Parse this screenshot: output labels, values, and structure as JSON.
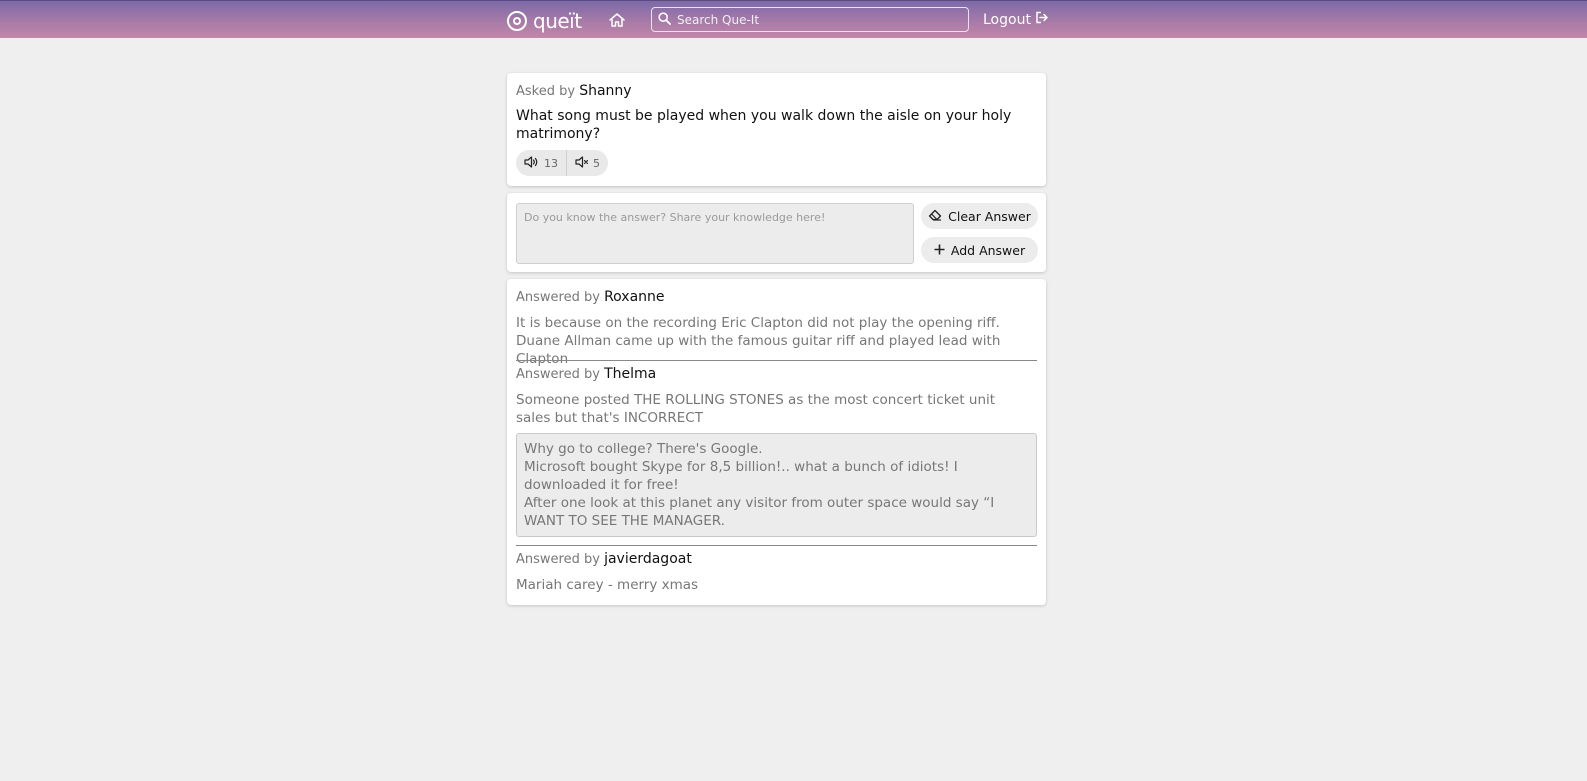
{
  "header": {
    "brand": "queït",
    "search_placeholder": "Search Que-It",
    "logout_label": "Logout"
  },
  "question": {
    "asked_prefix": "Asked by",
    "author": "Shanny",
    "text": "What song must be played when you walk down the aisle on your holy matrimony?",
    "upvotes": "13",
    "downvotes": "5"
  },
  "answer_form": {
    "placeholder": "Do you know the answer? Share your knowledge here!",
    "clear_label": "Clear Answer",
    "add_label": "Add Answer"
  },
  "answers": [
    {
      "prefix": "Answered by",
      "author": "Roxanne",
      "text": "It is because on the recording Eric Clapton did not play the opening riff. Duane Allman came up with the famous guitar riff and played lead with Clapton"
    },
    {
      "prefix": "Answered by",
      "author": "Thelma",
      "text": "Someone posted THE ROLLING STONES as the most concert ticket unit sales but that's INCORRECT",
      "quote_lines": [
        "Why go to college? There's Google.",
        "Microsoft bought Skype for 8,5 billion!.. what a bunch of idiots! I downloaded it for free!",
        "After one look at this planet any visitor from outer space would say “I WANT TO SEE THE MANAGER."
      ]
    },
    {
      "prefix": "Answered by",
      "author": "javierdagoat",
      "text": "Mariah carey - merry xmas"
    }
  ]
}
